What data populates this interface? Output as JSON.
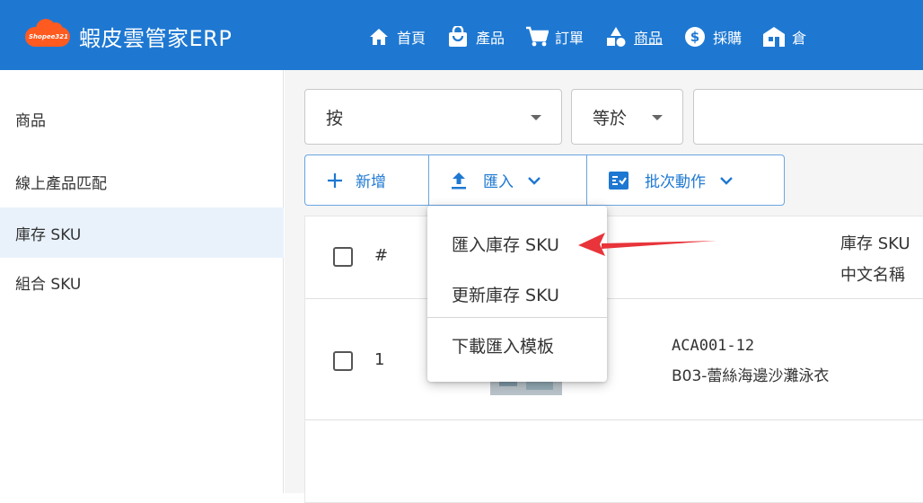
{
  "brand": {
    "logo_text": "Shopee321",
    "title": "蝦皮雲管家ERP"
  },
  "nav": [
    {
      "icon": "home-icon",
      "label": "首頁",
      "underline": false
    },
    {
      "icon": "shopping-bag-icon",
      "label": "產品",
      "underline": false
    },
    {
      "icon": "cart-icon",
      "label": "訂單",
      "underline": false
    },
    {
      "icon": "shapes-icon",
      "label": "商品",
      "underline": true
    },
    {
      "icon": "dollar-icon",
      "label": "採購",
      "underline": false
    },
    {
      "icon": "warehouse-icon",
      "label": "倉",
      "underline": false
    }
  ],
  "sidebar": {
    "items": [
      {
        "label": "商品",
        "active": false
      },
      {
        "label": "線上產品匹配",
        "active": false
      },
      {
        "label": "庫存 SKU",
        "active": true
      },
      {
        "label": "組合 SKU",
        "active": false
      }
    ]
  },
  "filters": {
    "field": "按",
    "operator": "等於",
    "value": ""
  },
  "toolbar": {
    "add_label": "新增",
    "import_label": "匯入",
    "batch_label": "批次動作"
  },
  "table": {
    "header": {
      "index_label": "#",
      "col_sku": "庫存 SKU",
      "col_name": "中文名稱"
    },
    "rows": [
      {
        "index": "1",
        "sku": "ACA001-12",
        "name": "B03-蕾絲海邊沙灘泳衣"
      }
    ]
  },
  "import_menu": {
    "items": [
      "匯入庫存 SKU",
      "更新庫存 SKU",
      "下載匯入模板"
    ]
  },
  "colors": {
    "primary": "#1e78d2",
    "annotation_arrow": "#e8343a",
    "active_bg": "#e9f2fb"
  }
}
